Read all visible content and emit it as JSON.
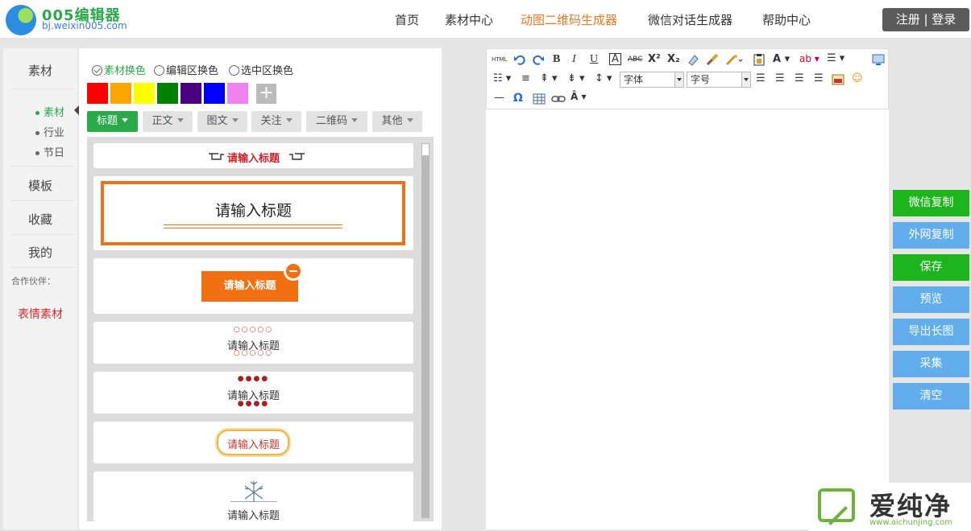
{
  "header": {
    "logo_title": "005编辑器",
    "logo_url": "bj.weixin005.com",
    "nav": [
      {
        "label": "首页",
        "active": false
      },
      {
        "label": "素材中心",
        "active": false
      },
      {
        "label": "动图二维码生成器",
        "active": true
      },
      {
        "label": "微信对话生成器",
        "active": false
      },
      {
        "label": "帮助中心",
        "active": false
      }
    ],
    "auth": "注册 | 登录"
  },
  "left_nav": {
    "items": [
      "素材",
      "模板",
      "收藏",
      "我的"
    ],
    "sub_items": [
      {
        "label": "素材",
        "active": true
      },
      {
        "label": "行业",
        "active": false
      },
      {
        "label": "节日",
        "active": false
      }
    ],
    "partner_label": "合作伙伴：",
    "emoji_link": "表情素材"
  },
  "material_panel": {
    "radios": [
      {
        "label": "素材换色",
        "checked": true
      },
      {
        "label": "编辑区换色",
        "checked": false
      },
      {
        "label": "选中区换色",
        "checked": false
      }
    ],
    "colors": [
      "#ff0000",
      "#ffa500",
      "#ffff00",
      "#008000",
      "#4b0082",
      "#0000ff",
      "#ee82ee"
    ],
    "add_color_symbol": "+",
    "tabs": [
      {
        "label": "标题",
        "active": true
      },
      {
        "label": "正文",
        "active": false
      },
      {
        "label": "图文",
        "active": false
      },
      {
        "label": "关注",
        "active": false
      },
      {
        "label": "二维码",
        "active": false
      },
      {
        "label": "其他",
        "active": false
      }
    ],
    "cards": [
      "请输入标题",
      "请输入标题",
      "请输入标题",
      "请输入标题",
      "请输入标题",
      "请输入标题",
      "请输入标题"
    ]
  },
  "toolbar": {
    "html_label": "HTML",
    "font_family": "字体",
    "font_size": "字号"
  },
  "side_buttons": [
    {
      "label": "微信复制",
      "color": "green"
    },
    {
      "label": "外网复制",
      "color": "blue"
    },
    {
      "label": "保存",
      "color": "green"
    },
    {
      "label": "预览",
      "color": "blue"
    },
    {
      "label": "导出长图",
      "color": "blue"
    },
    {
      "label": "采集",
      "color": "blue"
    },
    {
      "label": "清空",
      "color": "blue"
    }
  ],
  "watermark": {
    "text": "爱纯净",
    "url": "www.aichunjing.com"
  },
  "colors": {
    "accent_green": "#2aa94a",
    "accent_orange": "#e8731c",
    "button_blue": "#62adec",
    "button_green": "#1db41d"
  }
}
